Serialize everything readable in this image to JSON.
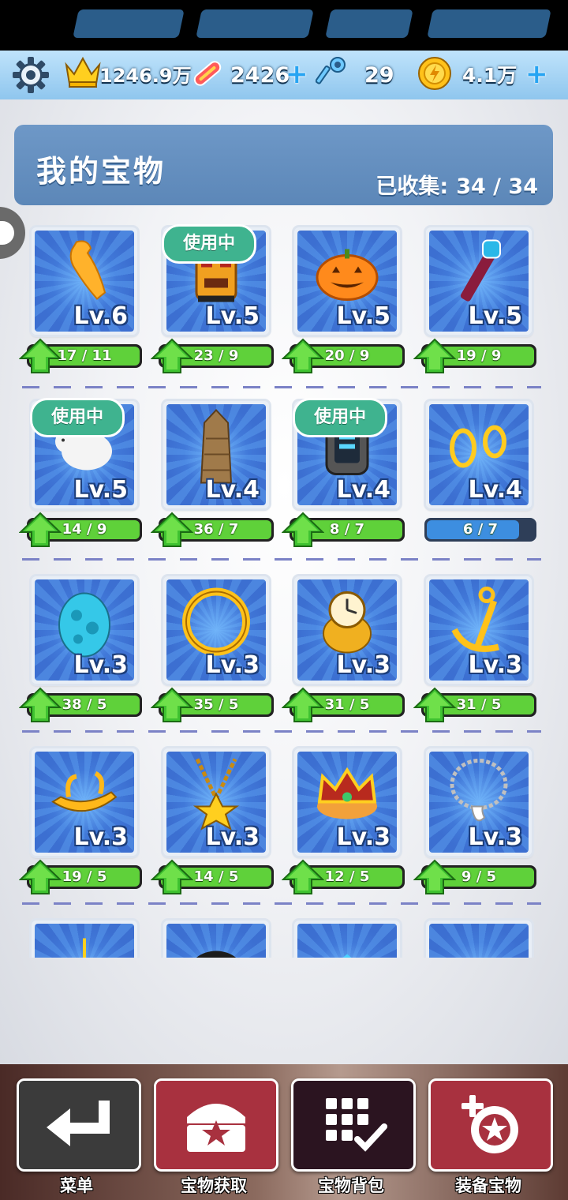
{
  "resources": {
    "crown_value": "1246.9万",
    "board_value": "2426",
    "key_value": "29",
    "coin_value": "4.1万",
    "plus_label": "+"
  },
  "header": {
    "title": "我的宝物",
    "collected_label": "已收集:",
    "collected_value": "34 / 34"
  },
  "in_use_label": "使用中",
  "items": [
    {
      "icon": "golden-bird-icon",
      "level": "Lv.6",
      "progress": "17 / 11",
      "upgradable": true,
      "in_use": false
    },
    {
      "icon": "tiki-totem-icon",
      "level": "Lv.5",
      "progress": "23 / 9",
      "upgradable": true,
      "in_use": true
    },
    {
      "icon": "pumpkin-icon",
      "level": "Lv.5",
      "progress": "20 / 9",
      "upgradable": true,
      "in_use": false
    },
    {
      "icon": "skull-staff-icon",
      "level": "Lv.5",
      "progress": "19 / 9",
      "upgradable": true,
      "in_use": false
    },
    {
      "icon": "white-bear-icon",
      "level": "Lv.5",
      "progress": "14 / 9",
      "upgradable": true,
      "in_use": true
    },
    {
      "icon": "skyscraper-icon",
      "level": "Lv.4",
      "progress": "36 / 7",
      "upgradable": true,
      "in_use": false
    },
    {
      "icon": "gadget-watch-icon",
      "level": "Lv.4",
      "progress": "8 / 7",
      "upgradable": true,
      "in_use": true
    },
    {
      "icon": "gold-rings-icon",
      "level": "Lv.4",
      "progress": "6 / 7",
      "upgradable": false,
      "fill": 0.86,
      "in_use": false
    },
    {
      "icon": "cyan-egg-icon",
      "level": "Lv.3",
      "progress": "38 / 5",
      "upgradable": true,
      "in_use": false
    },
    {
      "icon": "gold-ring-icon",
      "level": "Lv.3",
      "progress": "35 / 5",
      "upgradable": true,
      "in_use": false
    },
    {
      "icon": "clock-ring-icon",
      "level": "Lv.3",
      "progress": "31 / 5",
      "upgradable": true,
      "in_use": false
    },
    {
      "icon": "anchor-icon",
      "level": "Lv.3",
      "progress": "31 / 5",
      "upgradable": true,
      "in_use": false
    },
    {
      "icon": "gold-lamp-icon",
      "level": "Lv.3",
      "progress": "19 / 5",
      "upgradable": true,
      "in_use": false
    },
    {
      "icon": "star-necklace-icon",
      "level": "Lv.3",
      "progress": "14 / 5",
      "upgradable": true,
      "in_use": false
    },
    {
      "icon": "crown-icon",
      "level": "Lv.3",
      "progress": "12 / 5",
      "upgradable": true,
      "in_use": false
    },
    {
      "icon": "tooth-necklace-icon",
      "level": "Lv.3",
      "progress": "9 / 5",
      "upgradable": true,
      "in_use": false
    },
    {
      "icon": "hook-icon",
      "level": "",
      "progress": "",
      "upgradable": false,
      "in_use": false
    },
    {
      "icon": "black-helmet-icon",
      "level": "",
      "progress": "",
      "upgradable": false,
      "in_use": false
    },
    {
      "icon": "blue-gem-icon",
      "level": "",
      "progress": "",
      "upgradable": false,
      "in_use": false
    },
    {
      "icon": "red-hat-icon",
      "level": "",
      "progress": "",
      "upgradable": false,
      "in_use": false
    }
  ],
  "bottom_nav": {
    "menu": "菜单",
    "acquire": "宝物获取",
    "backpack": "宝物背包",
    "equip": "装备宝物"
  }
}
